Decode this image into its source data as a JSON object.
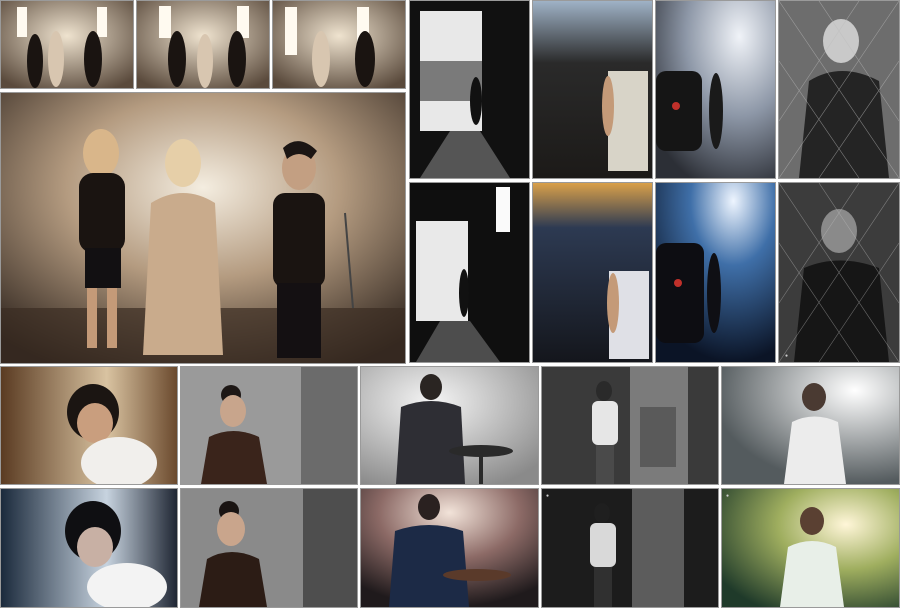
{
  "gallery": {
    "tiles": [
      {
        "id": "t01",
        "tone": "warm"
      },
      {
        "id": "t02",
        "tone": "warm"
      },
      {
        "id": "t03",
        "tone": "warm"
      },
      {
        "id": "t04",
        "tone": "warm-large"
      },
      {
        "id": "t05",
        "tone": "bw"
      },
      {
        "id": "t06",
        "tone": "dusk"
      },
      {
        "id": "t07",
        "tone": "blue"
      },
      {
        "id": "t08",
        "tone": "bw"
      },
      {
        "id": "t09",
        "tone": "bw"
      },
      {
        "id": "t10",
        "tone": "dusk"
      },
      {
        "id": "t11",
        "tone": "blue"
      },
      {
        "id": "t12",
        "tone": "bw"
      },
      {
        "id": "t13",
        "tone": "warm"
      },
      {
        "id": "t14",
        "tone": "grey"
      },
      {
        "id": "t15",
        "tone": "grey"
      },
      {
        "id": "t16",
        "tone": "bw"
      },
      {
        "id": "t17",
        "tone": "grey"
      },
      {
        "id": "t18",
        "tone": "blue"
      },
      {
        "id": "t19",
        "tone": "grey"
      },
      {
        "id": "t20",
        "tone": "warm"
      },
      {
        "id": "t21",
        "tone": "bw"
      },
      {
        "id": "t22",
        "tone": "green"
      }
    ]
  },
  "colors": {
    "tile_border": "#9a9a9a",
    "background": "#ffffff"
  }
}
